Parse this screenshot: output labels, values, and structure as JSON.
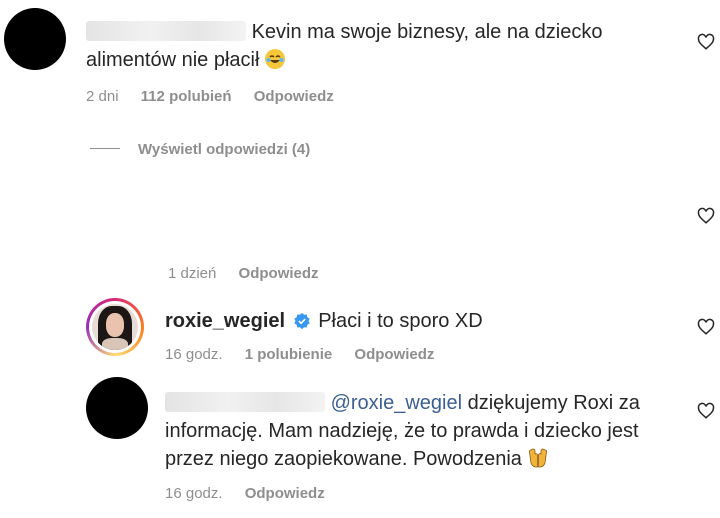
{
  "comments": [
    {
      "text": "Kevin ma swoje biznesy, ale na dziecko alimentów nie płacił",
      "time": "2 dni",
      "likes": "112 polubień",
      "reply": "Odpowiedz"
    }
  ],
  "view_replies": "Wyświetl odpowiedzi (4)",
  "replies": [
    {
      "time": "1 dzień",
      "reply": "Odpowiedz"
    },
    {
      "username": "roxie_wegiel",
      "text": "Płaci i to sporo XD",
      "time": "16 godz.",
      "likes": "1 polubienie",
      "reply": "Odpowiedz"
    },
    {
      "mention": "@roxie_wegiel",
      "text": "dziękujemy Roxi za informację. Mam nadzieję, że to prawda i dziecko jest przez niego zaopiekowane. Powodzenia",
      "time": "16 godz.",
      "reply": "Odpowiedz"
    }
  ],
  "icons": [
    "heart-icon",
    "verified-badge-icon",
    "tears-of-joy-emoji",
    "praying-hands-emoji"
  ],
  "colors": {
    "meta": "#8e8e8e",
    "mention": "#3b5f91",
    "verified": "#3897f0"
  }
}
